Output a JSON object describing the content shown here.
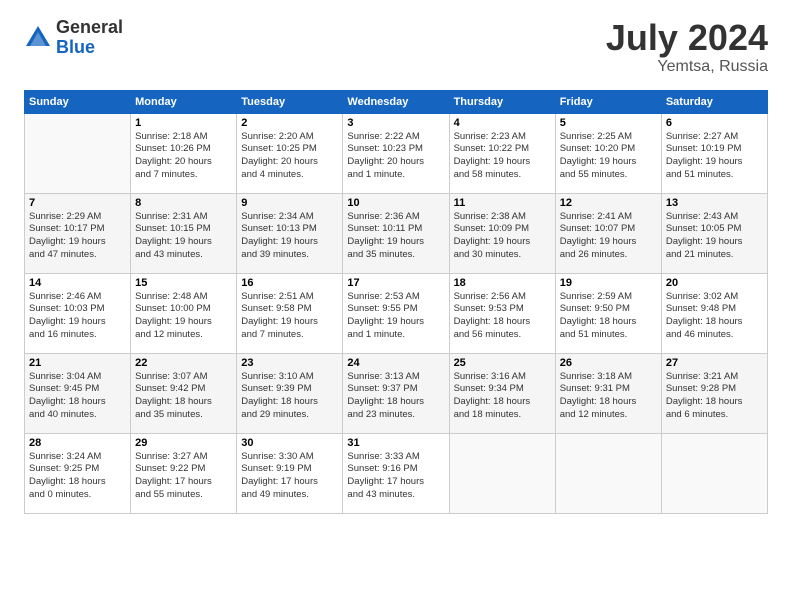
{
  "logo": {
    "general": "General",
    "blue": "Blue"
  },
  "title": {
    "month_year": "July 2024",
    "location": "Yemtsa, Russia"
  },
  "headers": [
    "Sunday",
    "Monday",
    "Tuesday",
    "Wednesday",
    "Thursday",
    "Friday",
    "Saturday"
  ],
  "weeks": [
    [
      {
        "day": "",
        "info": ""
      },
      {
        "day": "1",
        "info": "Sunrise: 2:18 AM\nSunset: 10:26 PM\nDaylight: 20 hours\nand 7 minutes."
      },
      {
        "day": "2",
        "info": "Sunrise: 2:20 AM\nSunset: 10:25 PM\nDaylight: 20 hours\nand 4 minutes."
      },
      {
        "day": "3",
        "info": "Sunrise: 2:22 AM\nSunset: 10:23 PM\nDaylight: 20 hours\nand 1 minute."
      },
      {
        "day": "4",
        "info": "Sunrise: 2:23 AM\nSunset: 10:22 PM\nDaylight: 19 hours\nand 58 minutes."
      },
      {
        "day": "5",
        "info": "Sunrise: 2:25 AM\nSunset: 10:20 PM\nDaylight: 19 hours\nand 55 minutes."
      },
      {
        "day": "6",
        "info": "Sunrise: 2:27 AM\nSunset: 10:19 PM\nDaylight: 19 hours\nand 51 minutes."
      }
    ],
    [
      {
        "day": "7",
        "info": "Sunrise: 2:29 AM\nSunset: 10:17 PM\nDaylight: 19 hours\nand 47 minutes."
      },
      {
        "day": "8",
        "info": "Sunrise: 2:31 AM\nSunset: 10:15 PM\nDaylight: 19 hours\nand 43 minutes."
      },
      {
        "day": "9",
        "info": "Sunrise: 2:34 AM\nSunset: 10:13 PM\nDaylight: 19 hours\nand 39 minutes."
      },
      {
        "day": "10",
        "info": "Sunrise: 2:36 AM\nSunset: 10:11 PM\nDaylight: 19 hours\nand 35 minutes."
      },
      {
        "day": "11",
        "info": "Sunrise: 2:38 AM\nSunset: 10:09 PM\nDaylight: 19 hours\nand 30 minutes."
      },
      {
        "day": "12",
        "info": "Sunrise: 2:41 AM\nSunset: 10:07 PM\nDaylight: 19 hours\nand 26 minutes."
      },
      {
        "day": "13",
        "info": "Sunrise: 2:43 AM\nSunset: 10:05 PM\nDaylight: 19 hours\nand 21 minutes."
      }
    ],
    [
      {
        "day": "14",
        "info": "Sunrise: 2:46 AM\nSunset: 10:03 PM\nDaylight: 19 hours\nand 16 minutes."
      },
      {
        "day": "15",
        "info": "Sunrise: 2:48 AM\nSunset: 10:00 PM\nDaylight: 19 hours\nand 12 minutes."
      },
      {
        "day": "16",
        "info": "Sunrise: 2:51 AM\nSunset: 9:58 PM\nDaylight: 19 hours\nand 7 minutes."
      },
      {
        "day": "17",
        "info": "Sunrise: 2:53 AM\nSunset: 9:55 PM\nDaylight: 19 hours\nand 1 minute."
      },
      {
        "day": "18",
        "info": "Sunrise: 2:56 AM\nSunset: 9:53 PM\nDaylight: 18 hours\nand 56 minutes."
      },
      {
        "day": "19",
        "info": "Sunrise: 2:59 AM\nSunset: 9:50 PM\nDaylight: 18 hours\nand 51 minutes."
      },
      {
        "day": "20",
        "info": "Sunrise: 3:02 AM\nSunset: 9:48 PM\nDaylight: 18 hours\nand 46 minutes."
      }
    ],
    [
      {
        "day": "21",
        "info": "Sunrise: 3:04 AM\nSunset: 9:45 PM\nDaylight: 18 hours\nand 40 minutes."
      },
      {
        "day": "22",
        "info": "Sunrise: 3:07 AM\nSunset: 9:42 PM\nDaylight: 18 hours\nand 35 minutes."
      },
      {
        "day": "23",
        "info": "Sunrise: 3:10 AM\nSunset: 9:39 PM\nDaylight: 18 hours\nand 29 minutes."
      },
      {
        "day": "24",
        "info": "Sunrise: 3:13 AM\nSunset: 9:37 PM\nDaylight: 18 hours\nand 23 minutes."
      },
      {
        "day": "25",
        "info": "Sunrise: 3:16 AM\nSunset: 9:34 PM\nDaylight: 18 hours\nand 18 minutes."
      },
      {
        "day": "26",
        "info": "Sunrise: 3:18 AM\nSunset: 9:31 PM\nDaylight: 18 hours\nand 12 minutes."
      },
      {
        "day": "27",
        "info": "Sunrise: 3:21 AM\nSunset: 9:28 PM\nDaylight: 18 hours\nand 6 minutes."
      }
    ],
    [
      {
        "day": "28",
        "info": "Sunrise: 3:24 AM\nSunset: 9:25 PM\nDaylight: 18 hours\nand 0 minutes."
      },
      {
        "day": "29",
        "info": "Sunrise: 3:27 AM\nSunset: 9:22 PM\nDaylight: 17 hours\nand 55 minutes."
      },
      {
        "day": "30",
        "info": "Sunrise: 3:30 AM\nSunset: 9:19 PM\nDaylight: 17 hours\nand 49 minutes."
      },
      {
        "day": "31",
        "info": "Sunrise: 3:33 AM\nSunset: 9:16 PM\nDaylight: 17 hours\nand 43 minutes."
      },
      {
        "day": "",
        "info": ""
      },
      {
        "day": "",
        "info": ""
      },
      {
        "day": "",
        "info": ""
      }
    ]
  ]
}
